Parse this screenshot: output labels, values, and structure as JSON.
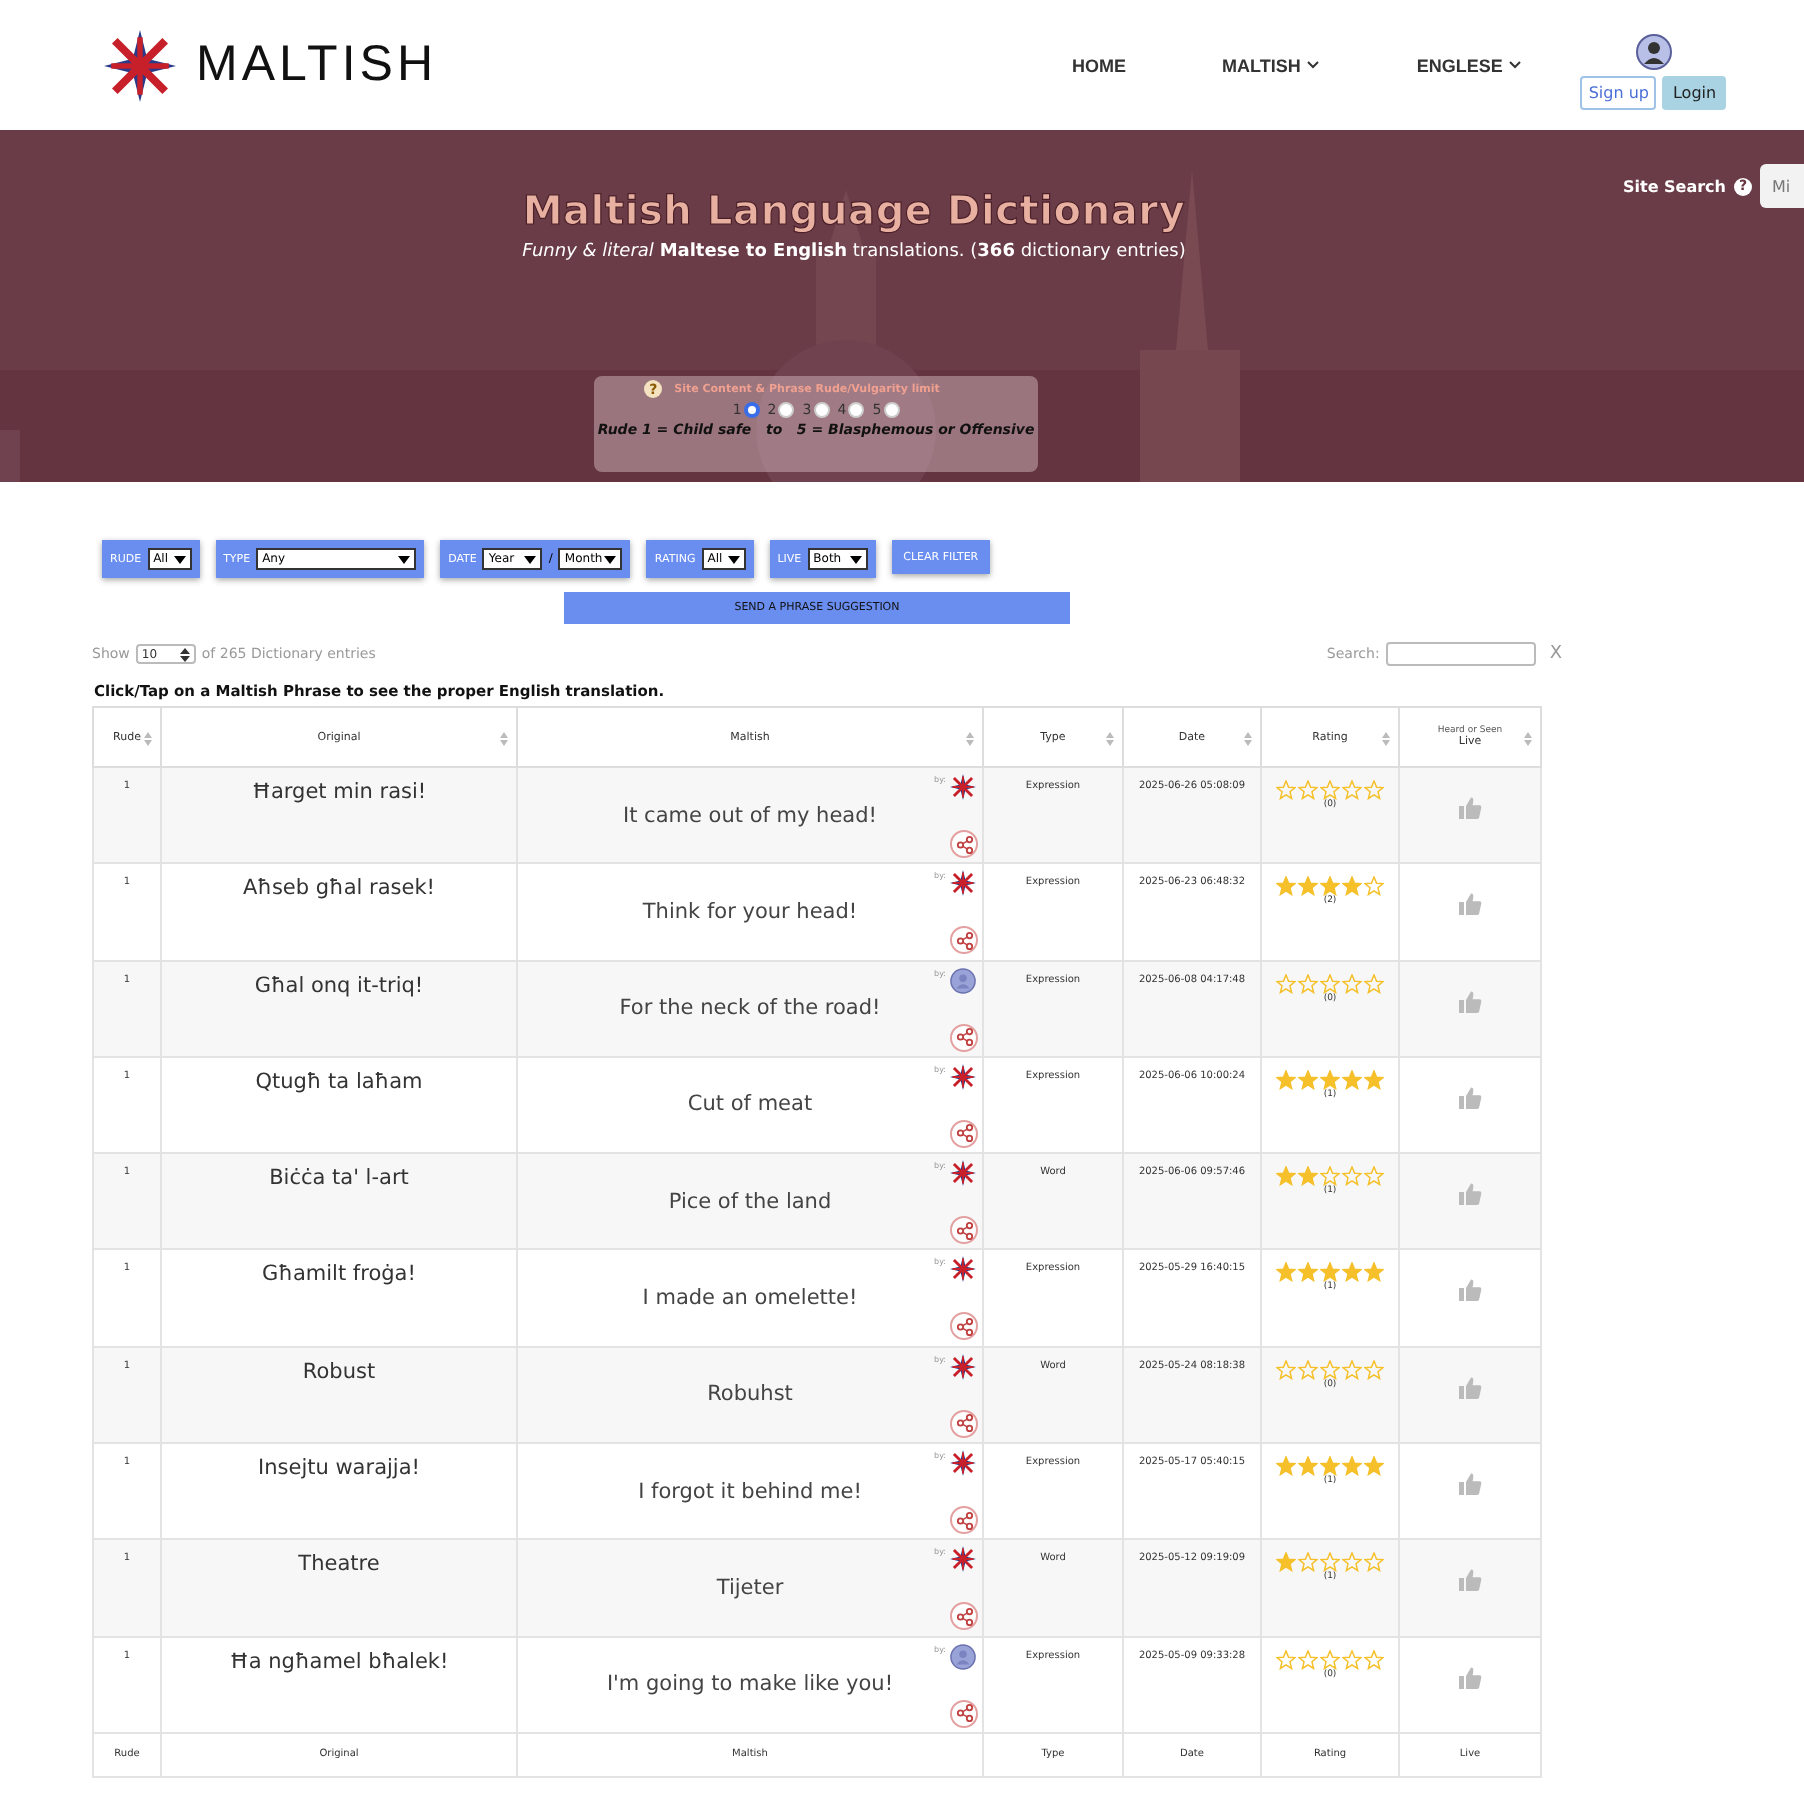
{
  "brand": "MALTISH",
  "nav": [
    {
      "label": "HOME",
      "dropdown": false
    },
    {
      "label": "MALTISH",
      "dropdown": true
    },
    {
      "label": "ENGLESE",
      "dropdown": true
    }
  ],
  "auth": {
    "signup": "Sign up",
    "login": "Login"
  },
  "site_search": {
    "label": "Site Search",
    "help": "?",
    "value": "Mi"
  },
  "hero": {
    "title": "Maltish Language Dictionary",
    "subtitle": "*Funny & literal* **Maltese to English** translations. (**366** dictionary entries)"
  },
  "rude_limit": {
    "help": "?",
    "title": "Site Content & Phrase Rude/Vulgarity limit",
    "options": [
      {
        "label": "1",
        "selected": true
      },
      {
        "label": "2",
        "selected": false
      },
      {
        "label": "3",
        "selected": false
      },
      {
        "label": "4",
        "selected": false
      },
      {
        "label": "5",
        "selected": false
      }
    ],
    "caption": "Rude 1 = Child safe   to   5 = Blasphemous or Offensive"
  },
  "filters": [
    {
      "label": "RUDE",
      "selects": [
        "All"
      ]
    },
    {
      "label": "TYPE",
      "selects": [
        "Any"
      ]
    },
    {
      "label": "DATE",
      "selects": [
        "Year",
        "Month"
      ],
      "separator": "/"
    },
    {
      "label": "RATING",
      "selects": [
        "All"
      ]
    },
    {
      "label": "LIVE",
      "selects": [
        "Both"
      ]
    }
  ],
  "clear_filter": "CLEAR FILTER",
  "suggest_button": "SEND A PHRASE SUGGESTION",
  "show": {
    "label": "Show",
    "value": "10",
    "suffix": "of 265 Dictionary entries"
  },
  "search": {
    "label": "Search:",
    "clear": "X"
  },
  "instruction": "Click/Tap on a Maltish Phrase to see the proper English translation.",
  "table": {
    "columns": [
      {
        "label": "Rude"
      },
      {
        "label": "Original"
      },
      {
        "label": "Maltish"
      },
      {
        "label": "Type"
      },
      {
        "label": "Date"
      },
      {
        "label": "Rating"
      },
      {
        "label": "Live",
        "note": "Heard or Seen"
      }
    ],
    "rows": [
      {
        "rude": "1",
        "original": "Ħarget min rasi!",
        "maltish": "It came out of my head!",
        "by_label": "by:",
        "author": {
          "kind": "flag"
        },
        "type": "Expression",
        "date": "2025-06-26 05:08:09",
        "stars": 0,
        "count": "(0)"
      },
      {
        "rude": "1",
        "original": "Aħseb għal rasek!",
        "maltish": "Think for your head!",
        "by_label": "by:",
        "author": {
          "kind": "flag"
        },
        "type": "Expression",
        "date": "2025-06-23 06:48:32",
        "stars": 4,
        "count": "(2)"
      },
      {
        "rude": "1",
        "original": "Għal onq it-triq!",
        "maltish": "For the neck of the road!",
        "by_label": "by:",
        "author": {
          "kind": "user"
        },
        "type": "Expression",
        "date": "2025-06-08 04:17:48",
        "stars": 0,
        "count": "(0)"
      },
      {
        "rude": "1",
        "original": "Qtugħ ta laħam",
        "maltish": "Cut of meat",
        "by_label": "by:",
        "author": {
          "kind": "flag"
        },
        "type": "Expression",
        "date": "2025-06-06 10:00:24",
        "stars": 5,
        "count": "(1)"
      },
      {
        "rude": "1",
        "original": "Biċċa ta' l-art",
        "maltish": "Pice of the land",
        "by_label": "by:",
        "author": {
          "kind": "flag"
        },
        "type": "Word",
        "date": "2025-06-06 09:57:46",
        "stars": 2,
        "count": "(1)"
      },
      {
        "rude": "1",
        "original": "Għamilt froġa!",
        "maltish": "I made an omelette!",
        "by_label": "by:",
        "author": {
          "kind": "flag"
        },
        "type": "Expression",
        "date": "2025-05-29 16:40:15",
        "stars": 5,
        "count": "(1)"
      },
      {
        "rude": "1",
        "original": "Robust",
        "maltish": "Robuhst",
        "by_label": "by:",
        "author": {
          "kind": "flag"
        },
        "type": "Word",
        "date": "2025-05-24 08:18:38",
        "stars": 0,
        "count": "(0)"
      },
      {
        "rude": "1",
        "original": "Insejtu warajja!",
        "maltish": "I forgot it behind me!",
        "by_label": "by:",
        "author": {
          "kind": "flag"
        },
        "type": "Expression",
        "date": "2025-05-17 05:40:15",
        "stars": 5,
        "count": "(1)"
      },
      {
        "rude": "1",
        "original": "Theatre",
        "maltish": "Tijeter",
        "by_label": "by:",
        "author": {
          "kind": "flag"
        },
        "type": "Word",
        "date": "2025-05-12 09:19:09",
        "stars": 1,
        "count": "(1)"
      },
      {
        "rude": "1",
        "original": "Ħa ngħamel bħalek!",
        "maltish": "I'm going to make like you!",
        "by_label": "by:",
        "author": {
          "kind": "user"
        },
        "type": "Expression",
        "date": "2025-05-09 09:33:28",
        "stars": 0,
        "count": "(0)"
      }
    ],
    "footer": [
      "Rude",
      "Original",
      "Maltish",
      "Type",
      "Date",
      "Rating",
      "Live"
    ]
  }
}
